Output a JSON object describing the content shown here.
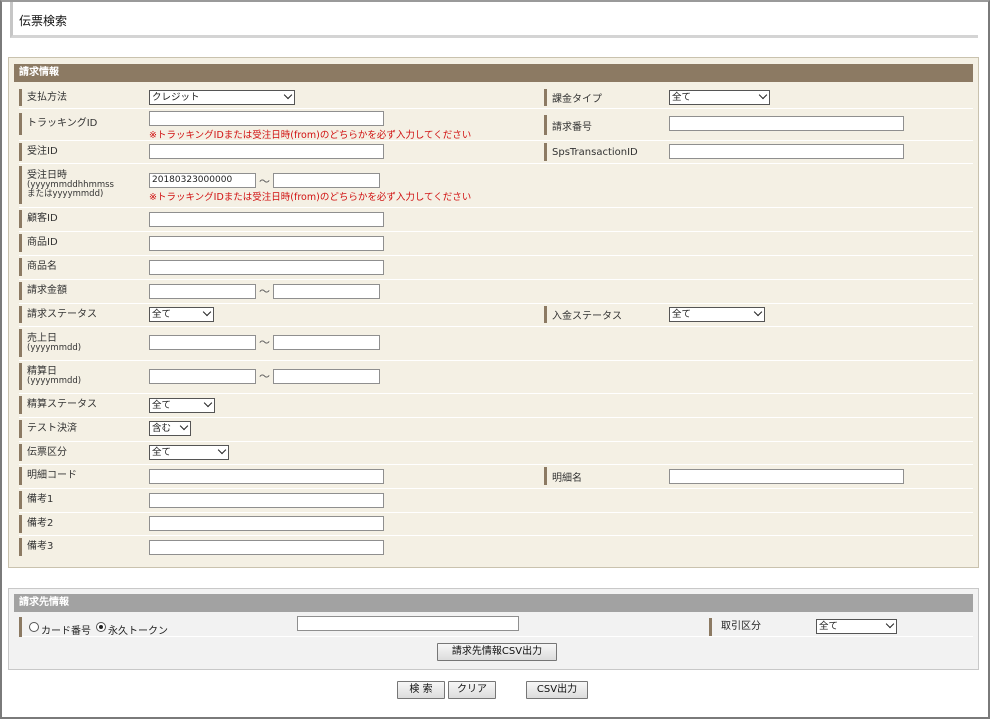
{
  "page": {
    "title": "伝票検索"
  },
  "billing": {
    "header": "請求情報",
    "payment_method": {
      "label": "支払方法",
      "value": "クレジット"
    },
    "charge_type": {
      "label": "課金タイプ",
      "value": "全て"
    },
    "tracking_id": {
      "label": "トラッキングID",
      "value": "",
      "note": "※トラッキングIDまたは受注日時(from)のどちらかを必ず入力してください"
    },
    "billing_number": {
      "label": "請求番号",
      "value": ""
    },
    "order_id": {
      "label": "受注ID",
      "value": ""
    },
    "sps_transaction_id": {
      "label": "SpsTransactionID",
      "value": ""
    },
    "order_datetime": {
      "label": "受注日時",
      "sub1": "(yyyymmddhhmmss",
      "sub2": "またはyyyymmdd)",
      "from": "20180323000000",
      "to": "",
      "tilde": "～",
      "note": "※トラッキングIDまたは受注日時(from)のどちらかを必ず入力してください"
    },
    "customer_id": {
      "label": "顧客ID",
      "value": ""
    },
    "product_id": {
      "label": "商品ID",
      "value": ""
    },
    "product_name": {
      "label": "商品名",
      "value": ""
    },
    "billing_amount": {
      "label": "請求金額",
      "from": "",
      "to": "",
      "tilde": "～"
    },
    "billing_status": {
      "label": "請求ステータス",
      "value": "全て"
    },
    "payment_status": {
      "label": "入金ステータス",
      "value": "全て"
    },
    "sales_date": {
      "label": "売上日",
      "sub": "(yyyymmdd)",
      "from": "",
      "to": "",
      "tilde": "～"
    },
    "settlement_date": {
      "label": "精算日",
      "sub": "(yyyymmdd)",
      "from": "",
      "to": "",
      "tilde": "～"
    },
    "settlement_status": {
      "label": "精算ステータス",
      "value": "全て"
    },
    "test_payment": {
      "label": "テスト決済",
      "value": "含む"
    },
    "slip_type": {
      "label": "伝票区分",
      "value": "全て"
    },
    "detail_code": {
      "label": "明細コード",
      "value": ""
    },
    "detail_name": {
      "label": "明細名",
      "value": ""
    },
    "remarks1": {
      "label": "備考1",
      "value": ""
    },
    "remarks2": {
      "label": "備考2",
      "value": ""
    },
    "remarks3": {
      "label": "備考3",
      "value": ""
    }
  },
  "billing_dest": {
    "header": "請求先情報",
    "radio_card": "カード番号",
    "radio_token": "永久トークン",
    "selected": "永久トークン",
    "input_value": "",
    "category": {
      "label": "取引区分",
      "value": "全て"
    },
    "csv_button": "請求先情報CSV出力"
  },
  "actions": {
    "search": "検 索",
    "clear": "クリア",
    "csv": "CSV出力"
  }
}
